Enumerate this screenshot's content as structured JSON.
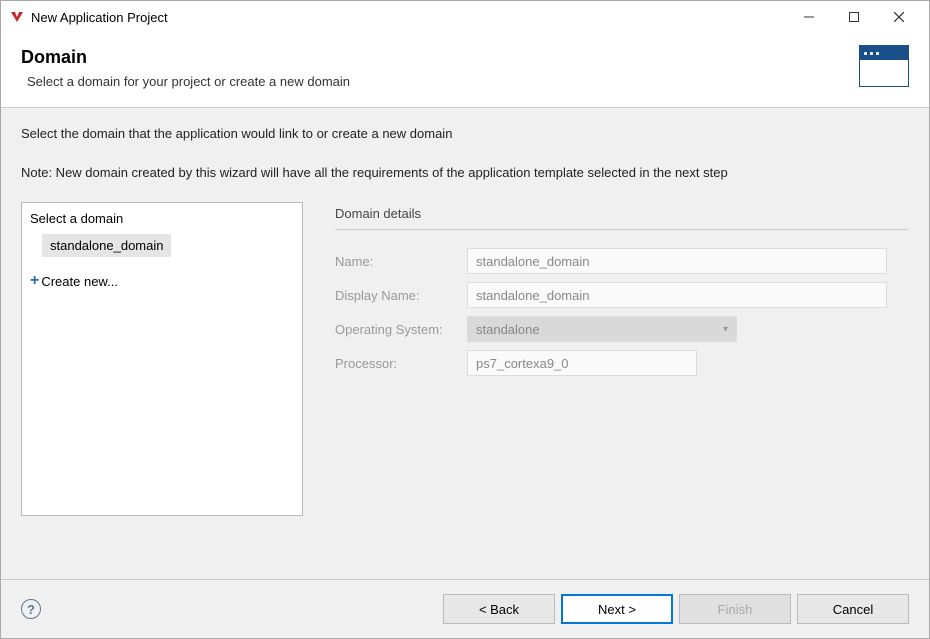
{
  "titlebar": {
    "title": "New Application Project"
  },
  "header": {
    "title": "Domain",
    "subtitle": "Select a domain for your project or create a new domain"
  },
  "body": {
    "instruction": "Select the domain that the application would link to or create a new domain",
    "note": "Note: New domain created by this wizard will have all the requirements of the application template selected in the next step"
  },
  "left": {
    "label": "Select a domain",
    "selected_domain": "standalone_domain",
    "create_new": "Create new..."
  },
  "details": {
    "title": "Domain details",
    "name_label": "Name:",
    "name_value": "standalone_domain",
    "display_name_label": "Display Name:",
    "display_name_value": "standalone_domain",
    "os_label": "Operating System:",
    "os_value": "standalone",
    "processor_label": "Processor:",
    "processor_value": "ps7_cortexa9_0"
  },
  "footer": {
    "back": "< Back",
    "next": "Next >",
    "finish": "Finish",
    "cancel": "Cancel"
  }
}
